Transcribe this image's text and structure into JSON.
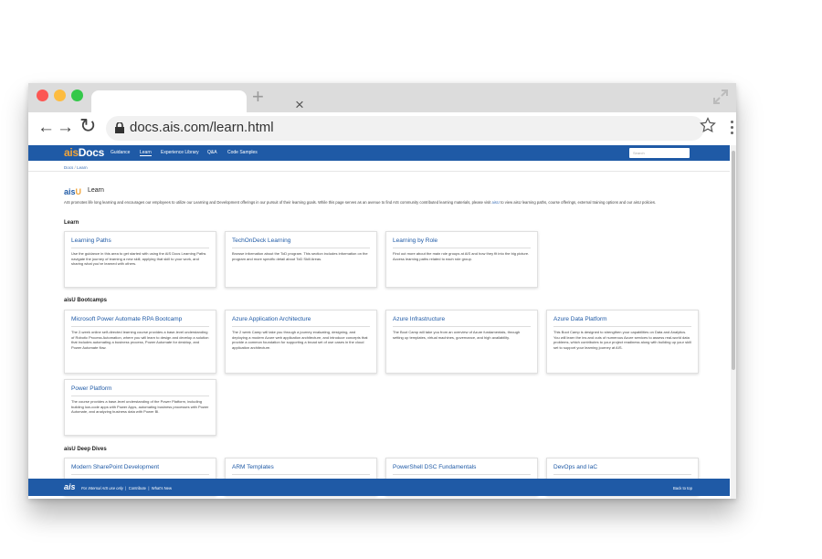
{
  "browser": {
    "tab_close": "×",
    "new_tab": "+",
    "url": "docs.ais.com/learn.html",
    "back": "←",
    "forward": "→",
    "reload": "↻"
  },
  "site": {
    "logo_a": "ais",
    "logo_b": "Docs",
    "nav": [
      "Guidance",
      "Learn",
      "Experience Library",
      "Q&A",
      "Code Samples"
    ],
    "search_placeholder": "Search",
    "breadcrumb": [
      "Docs",
      "Learn"
    ],
    "brand_color": "#1f5aa6",
    "accent_color": "#f0a43a"
  },
  "header": {
    "logo_a": "ais",
    "logo_b": "U",
    "title": "Learn",
    "intro": "AIS promotes life long learning and encourages our employees to utilize our Learning and Development offerings in our pursuit of their learning goals. While this page serves as an avenue to find AIS community contributed learning materials, please visit",
    "intro_link": "aisU",
    "intro_after": "to view aisU learning paths, course offerings, external training options and our aisU policies."
  },
  "sections": {
    "learn": "Learn",
    "bootcamps": "aisU Bootcamps",
    "deepdives": "aisU Deep Dives"
  },
  "cards": [
    {
      "title": "Learning Paths",
      "desc": "Use the guidance in this area to get started with using the AIS Docs Learning Paths navigate the journey of learning a new skill, applying that skill to your work, and sharing what you've learned with others."
    },
    {
      "title": "TechOnDeck Learning",
      "desc": "Browse information about the ToD program. This section includes information on the program and more specific detail about ToD Skill Areas."
    },
    {
      "title": "Learning by Role",
      "desc": "Find out more about the main role groups at AIS and how they fit into the big picture. Access learning paths related to each role group."
    },
    {
      "title": "Microsoft Power Automate RPA Bootcamp",
      "desc": "The 2-week online self-directed learning course provides a base-level understanding of Robotic Process Automation, where you will learn to design and develop a solution that includes automating a business process, Power Automate for desktop, and Power Automate flow."
    },
    {
      "title": "Azure Application Architecture",
      "desc": "The 2 week Camp will take you through a journey evaluating, designing, and deploying a modern Azure web application architecture, and introduce concepts that provide a common foundation for supporting a broad set of use cases in the cloud application architecture."
    },
    {
      "title": "Azure Infrastructure",
      "desc": "The Boot Camp will take you from an overview of Azure fundamentals, through setting up templates, virtual machines, governance, and high availability."
    },
    {
      "title": "Azure Data Platform",
      "desc": "This Boot Camp is designed to strengthen your capabilities on Data and Analytics. You will learn the ins and outs of numerous Azure services to assess real-world data problems, which contributes to your project readiness along with building up your skill set to support your learning journey at AIS."
    },
    {
      "title": "Power Platform",
      "desc": "The course provides a base-level understanding of the Power Platform, including building low-code apps with Power Apps, automating business processes with Power Automate, and analyzing business data with Power BI."
    },
    {
      "title": "Modern SharePoint Development",
      "desc": ""
    },
    {
      "title": "ARM Templates",
      "desc": ""
    },
    {
      "title": "PowerShell DSC Fundamentals",
      "desc": ""
    },
    {
      "title": "DevOps and IaC",
      "desc": ""
    }
  ],
  "footer": {
    "logo": "ais",
    "internal": "For Internal AIS use only",
    "contribute": "Contribute",
    "whats_new": "What's New",
    "back_to_top": "Back to top"
  }
}
